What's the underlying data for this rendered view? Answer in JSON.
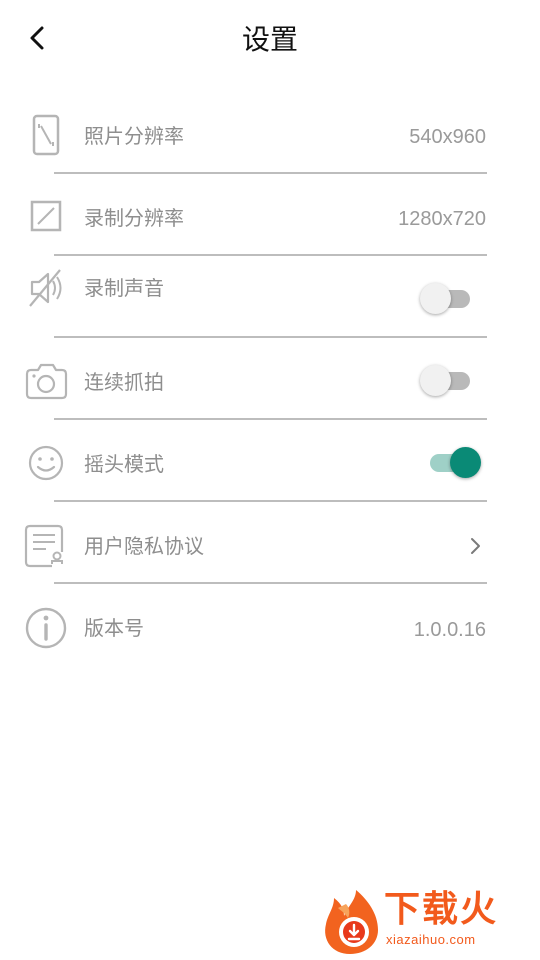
{
  "header": {
    "title": "设置",
    "back_icon": "chevron-left-icon"
  },
  "settings": [
    {
      "label": "照片分辨率",
      "value": "540x960",
      "icon": "photo-resolution-icon"
    },
    {
      "label": "录制分辨率",
      "value": "1280x720",
      "icon": "record-resolution-icon"
    },
    {
      "label": "录制声音",
      "icon": "mute-speaker-icon",
      "toggle": false
    },
    {
      "label": "连续抓拍",
      "icon": "camera-icon",
      "toggle": false
    },
    {
      "label": "摇头模式",
      "icon": "smile-icon",
      "toggle": true
    },
    {
      "label": "用户隐私协议",
      "icon": "privacy-document-icon",
      "chevron": "chevron-right-icon"
    },
    {
      "label": "版本号",
      "value": "1.0.0.16",
      "icon": "info-icon"
    }
  ],
  "watermark": {
    "name": "下载火",
    "url": "xiazaihuo.com",
    "logo": "flame-logo"
  },
  "colors": {
    "accent": "#0a8a76",
    "accent_track": "#9fd0c7",
    "off_track": "#b9b9b9",
    "label": "#8e8e8e",
    "divider": "#bdbdbd",
    "watermark": "#f25a1c"
  }
}
